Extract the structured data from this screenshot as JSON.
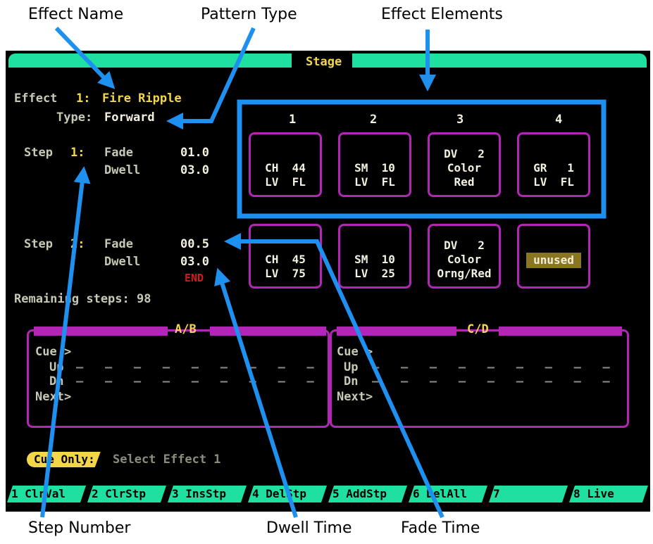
{
  "annotations": {
    "effect_name": "Effect Name",
    "pattern_type": "Pattern Type",
    "effect_elements": "Effect Elements",
    "step_number": "Step Number",
    "dwell_time": "Dwell Time",
    "fade_time": "Fade Time"
  },
  "screen": {
    "title": "Stage",
    "effect_label": "Effect",
    "effect_number": "1:",
    "effect_name": "Fire Ripple",
    "type_label": "Type:",
    "type_value": "Forward",
    "columns": [
      "1",
      "2",
      "3",
      "4"
    ],
    "steps": [
      {
        "label": "Step",
        "number": "1:",
        "fade_label": "Fade",
        "fade_value": "01.0",
        "dwell_label": "Dwell",
        "dwell_value": "03.0",
        "cells": [
          {
            "l1": "",
            "l2": "CH  44",
            "l3": "LV  FL"
          },
          {
            "l1": "",
            "l2": "SM  10",
            "l3": "LV  FL"
          },
          {
            "l1": "DV   2",
            "l2": "Color",
            "l3": "Red"
          },
          {
            "l1": "",
            "l2": "GR   1",
            "l3": "LV  FL"
          }
        ]
      },
      {
        "label": "Step",
        "number": "2:",
        "fade_label": "Fade",
        "fade_value": "00.5",
        "dwell_label": "Dwell",
        "dwell_value": "03.0",
        "end_marker": "END",
        "cells": [
          {
            "l1": "",
            "l2": "CH  45",
            "l3": "LV  75"
          },
          {
            "l1": "",
            "l2": "SM  10",
            "l3": "LV  25"
          },
          {
            "l1": "DV   2",
            "l2": "Color",
            "l3": "Orng/Red"
          },
          {
            "l1": "",
            "l2": "unused",
            "l3": ""
          }
        ]
      }
    ],
    "remaining_steps": "Remaining steps: 98",
    "panels": [
      {
        "title": "A/B",
        "cue": "Cue >",
        "up": "Up",
        "dn": "Dn",
        "next": "Next>"
      },
      {
        "title": "C/D",
        "cue": "Cue >",
        "up": "Up",
        "dn": "Dn",
        "next": "Next>"
      }
    ],
    "mode_badge": "Cue Only:",
    "prompt": "Select Effect 1",
    "function_keys": [
      "1 ClrVal",
      "2 ClrStp",
      "3 InsStp",
      "4 DelStp",
      "5 AddStp",
      "6 DelAll",
      "7",
      "8 Live"
    ]
  },
  "colors": {
    "screen_bg": "#000000",
    "accent_teal": "#1fe0a0",
    "border_purple": "#b226b6",
    "callout_blue": "#1e90f0",
    "yellow_text": "#f3d64a",
    "end_red": "#d31a1a"
  }
}
